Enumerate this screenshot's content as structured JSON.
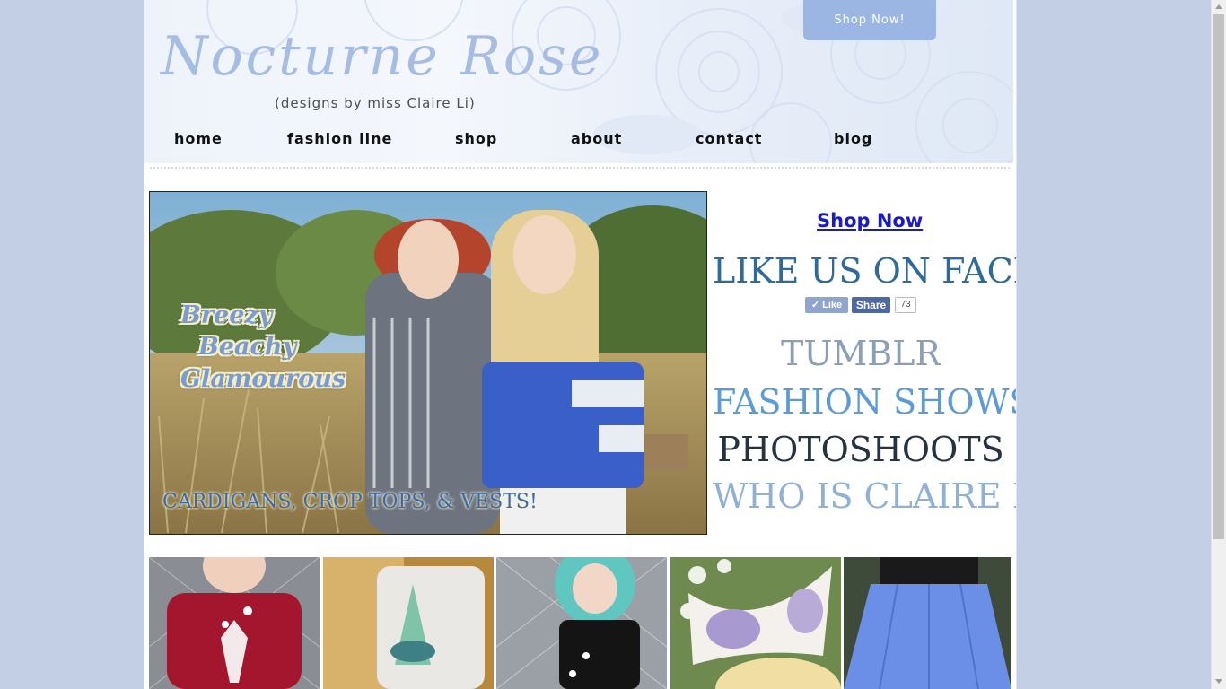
{
  "header": {
    "shop_now_button": "Shop Now!",
    "logo_title": "Nocturne Rose",
    "logo_subtitle": "(designs by miss Claire Li)"
  },
  "nav": {
    "items": [
      {
        "label": "home"
      },
      {
        "label": "fashion line"
      },
      {
        "label": "shop"
      },
      {
        "label": "about"
      },
      {
        "label": "contact"
      },
      {
        "label": "blog"
      }
    ]
  },
  "hero": {
    "overlay_lines": [
      "Breezy",
      "Beachy",
      "Glamourous"
    ],
    "caption": "CARDIGANS, CROP TOPS, & VESTS!"
  },
  "sidebar": {
    "shop_now_link": "Shop Now",
    "facebook_heading": "LIKE US ON FACEBOOK!",
    "facebook": {
      "like_label": "Like",
      "share_label": "Share",
      "share_count": "73"
    },
    "links": [
      {
        "label": "TUMBLR",
        "color": "#8ba0b6"
      },
      {
        "label": "FASHION SHOWS",
        "color": "#5d9bd6"
      },
      {
        "label": "PHOTOSHOOTS",
        "color": "#26323f"
      },
      {
        "label": "WHO IS CLAIRE LI?",
        "color": "#8fb1d4"
      }
    ]
  },
  "gallery": {
    "items": [
      {
        "name": "red-butterfly-top"
      },
      {
        "name": "white-crop-top"
      },
      {
        "name": "black-butterfly-tank"
      },
      {
        "name": "script-print-bow"
      },
      {
        "name": "blue-pleated-skirt"
      }
    ]
  },
  "colors": {
    "page_background": "#c2cfe5",
    "accent_blue": "#9cb6e4",
    "logo_color": "#a5bce3",
    "link_blue": "#1b1bc6"
  }
}
